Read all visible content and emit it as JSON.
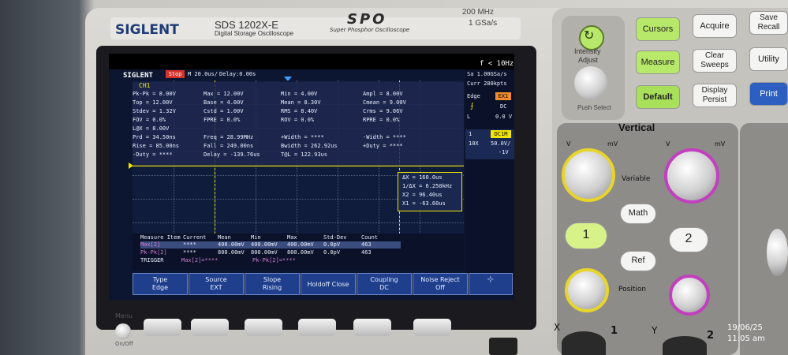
{
  "device": {
    "brand": "SIGLENT",
    "model": "SDS 1202X-E",
    "model_sub": "Digital Storage Oscilloscope",
    "spo_logo": "SPO",
    "spo_sub": "Super Phosphor Oscilloscope",
    "bandwidth": "200 MHz",
    "sample_rate": "1 GSa/s"
  },
  "screen": {
    "logo": "SIGLENT",
    "status": "Stop",
    "timebase": "M 20.0us/",
    "delay": "Delay:0.00s",
    "freq_counter": "f < 10Hz",
    "sa": "Sa 1.00GSa/s",
    "curr": "Curr 280kpts",
    "trigger_label": "Edge",
    "trigger_source": "EX1",
    "coupling": "DC",
    "level_label": "L",
    "level_value": "0.0 V",
    "ch_num": "1",
    "ch_coupling": "DC1M",
    "probe": "10X",
    "vdiv": "50.0V/",
    "offset": "-1V",
    "meas_title": "CH1",
    "measurements": [
      {
        "a": "Pk-Pk = 8.00V",
        "b": "Max = 12.00V",
        "c": "Min = 4.00V",
        "d": "Ampl = 8.00V"
      },
      {
        "a": "Top = 12.00V",
        "b": "Base = 4.00V",
        "c": "Mean = 8.30V",
        "d": "Cmean = 9.00V"
      },
      {
        "a": "Stdev = 1.32V",
        "b": "Cstd = 1.00V",
        "c": "RMS = 8.40V",
        "d": "Crms = 9.06V"
      },
      {
        "a": "FOV = 0.0%",
        "b": "FPRE = 0.0%",
        "c": "ROV = 0.0%",
        "d": "RPRE = 0.0%"
      },
      {
        "a": "L@X = 8.00V",
        "b": "",
        "c": "",
        "d": ""
      },
      {
        "a": "Prd = 34.50ns",
        "b": "Freq = 28.99MHz",
        "c": "+Width = ****",
        "d": "-Width = ****"
      },
      {
        "a": "Rise = 85.00ns",
        "b": "Fall = 249.00ns",
        "c": "Bwidth = 262.92us",
        "d": "+Duty = ****"
      },
      {
        "a": "-Duty = ****",
        "b": "Delay = -139.76us",
        "c": "T@L = 122.93us",
        "d": ""
      }
    ],
    "cursor_box": {
      "dx": "ΔX = 160.0us",
      "inv_dx": "1/ΔX = 6.250kHz",
      "x2": "X2 = 96.40us",
      "x1": "X1 = -63.60us"
    },
    "stats_table": {
      "headers": [
        "Measure Item",
        "Current",
        "Mean",
        "Min",
        "Max",
        "Std-Dev",
        "Count"
      ],
      "rows": [
        [
          "Max[2]",
          "****",
          "400.00mV",
          "400.00mV",
          "400.00mV",
          "0.0pV",
          "463"
        ],
        [
          "Pk-Pk[2]",
          "****",
          "800.00mV",
          "800.00mV",
          "800.00mV",
          "0.0pV",
          "463"
        ]
      ],
      "trigger_row": "TRIGGER",
      "trig_items": [
        "Max[2]=****",
        "Pk-Pk[2]=****"
      ]
    },
    "menu": [
      {
        "top": "Type",
        "bottom": "Edge"
      },
      {
        "top": "Source",
        "bottom": "EXT"
      },
      {
        "top": "Slope",
        "bottom": "Rising"
      },
      {
        "top": "Holdoff Close",
        "bottom": ""
      },
      {
        "top": "Coupling",
        "bottom": "DC"
      },
      {
        "top": "Noise Reject",
        "bottom": "Off"
      }
    ]
  },
  "panel": {
    "intensity": "Intensity",
    "adjust": "Adjust",
    "push_select": "Push Select",
    "buttons": {
      "cursors": "Cursors",
      "acquire": "Acquire",
      "save": "Save",
      "recall": "Recall",
      "measure": "Measure",
      "clear": "Clear",
      "sweeps": "Sweeps",
      "utility": "Utility",
      "default": "Default",
      "display": "Display",
      "persist": "Persist",
      "print": "Print"
    },
    "vertical": "Vertical",
    "variable": "Variable",
    "math": "Math",
    "ref": "Ref",
    "ch1": "1",
    "ch2": "2",
    "position": "Position",
    "v_label": "V",
    "mv_label": "mV",
    "menu_label": "Menu",
    "on_off": "On/Off",
    "x_label": "X",
    "y_label": "Y",
    "x_num": "1",
    "y_num": "2"
  },
  "photo_stamp": {
    "date": "19/06/25",
    "time": "11:05 am"
  },
  "colors": {
    "ch1": "#f2e600",
    "screen_bg": "#0d1630",
    "menu_bg": "#1f3f8c",
    "green_btn": "#a8e05a",
    "accent_blue": "#2c5fc0"
  }
}
